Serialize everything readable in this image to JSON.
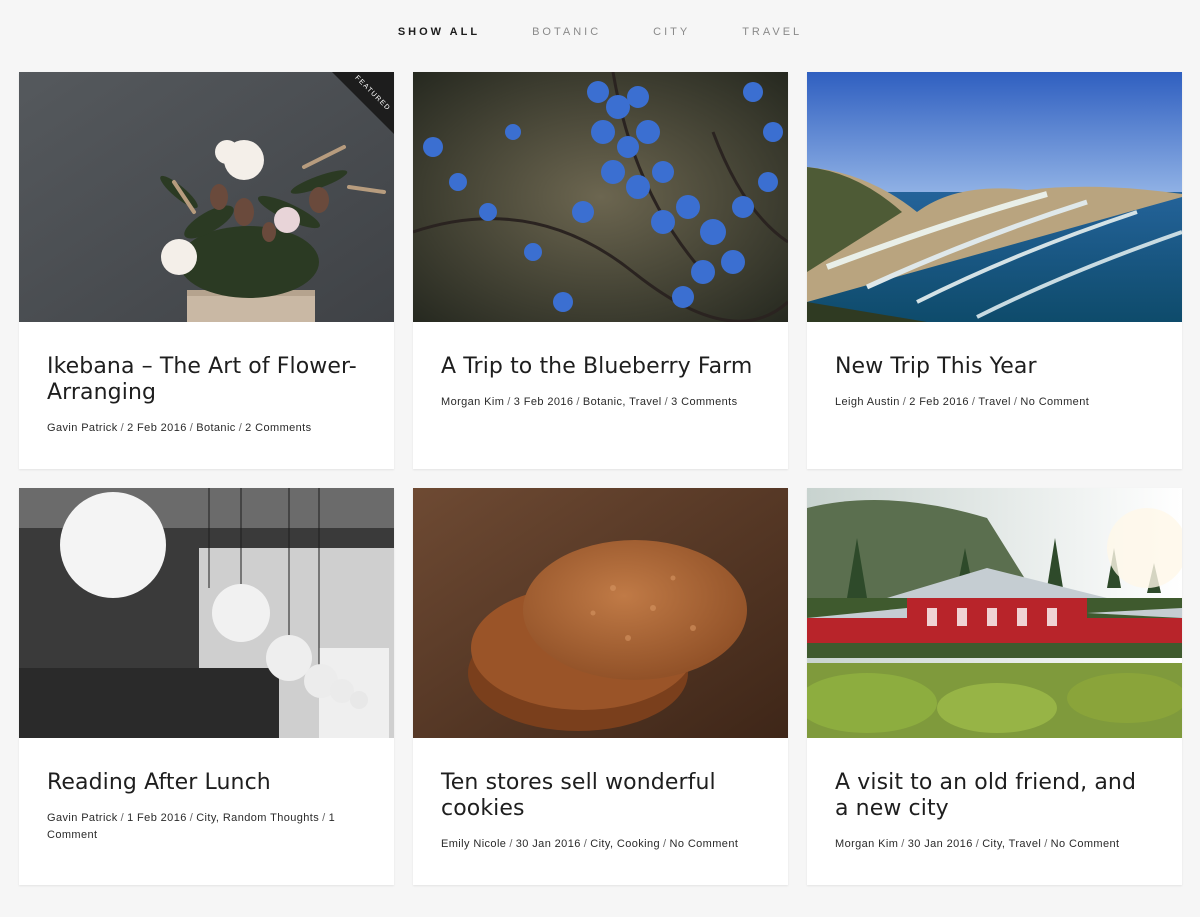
{
  "filters": [
    {
      "label": "SHOW ALL",
      "active": true
    },
    {
      "label": "BOTANIC",
      "active": false
    },
    {
      "label": "CITY",
      "active": false
    },
    {
      "label": "TRAVEL",
      "active": false
    }
  ],
  "featured_label": "FEATURED",
  "posts": [
    {
      "title": "Ikebana – The Art of Flower-Arranging",
      "author": "Gavin Patrick",
      "date": "2 Feb 2016",
      "categories": "Botanic",
      "comments": "2 Comments",
      "featured": true,
      "image": "flower-arrangement-image"
    },
    {
      "title": "A Trip to the Blueberry Farm",
      "author": "Morgan Kim",
      "date": "3 Feb 2016",
      "categories": "Botanic, Travel",
      "comments": "3 Comments",
      "featured": false,
      "image": "blueberries-image"
    },
    {
      "title": "New Trip This Year",
      "author": "Leigh Austin",
      "date": "2 Feb 2016",
      "categories": "Travel",
      "comments": "No Comment",
      "featured": false,
      "image": "coastline-image"
    },
    {
      "title": "Reading After Lunch",
      "author": "Gavin Patrick",
      "date": "1 Feb 2016",
      "categories": "City, Random Thoughts",
      "comments": "1 Comment",
      "featured": false,
      "image": "cafe-lamps-image"
    },
    {
      "title": "Ten stores sell wonderful cookies",
      "author": "Emily Nicole",
      "date": "30 Jan 2016",
      "categories": "City, Cooking",
      "comments": "No Comment",
      "featured": false,
      "image": "cookies-image"
    },
    {
      "title": "A visit to an old friend, and a new city",
      "author": "Morgan Kim",
      "date": "30 Jan 2016",
      "categories": "City, Travel",
      "comments": "No Comment",
      "featured": false,
      "image": "temple-image"
    }
  ]
}
